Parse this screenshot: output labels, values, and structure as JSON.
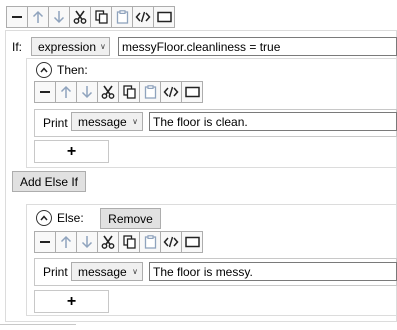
{
  "toolbar_icons": [
    "minus-icon",
    "arrow-up-icon",
    "arrow-down-icon",
    "scissors-icon",
    "copy-icon",
    "paste-icon",
    "code-icon",
    "rectangle-icon"
  ],
  "if_block": {
    "label": "If:",
    "condition_type": "expression",
    "condition_value": "messyFloor.cleanliness = true"
  },
  "then_block": {
    "label": "Then:",
    "statement": {
      "command": "Print",
      "type": "message",
      "value": "The floor is clean."
    },
    "add_label": "+"
  },
  "add_else_if_label": "Add Else If",
  "else_block": {
    "label": "Else:",
    "remove_label": "Remove",
    "statement": {
      "command": "Print",
      "type": "message",
      "value": "The floor is messy."
    },
    "add_label": "+"
  },
  "colors": {
    "enabled_icon": "#222222",
    "disabled_icon": "#8fa3bd",
    "button_bg": "#e1e1e1",
    "border": "#adadad"
  }
}
